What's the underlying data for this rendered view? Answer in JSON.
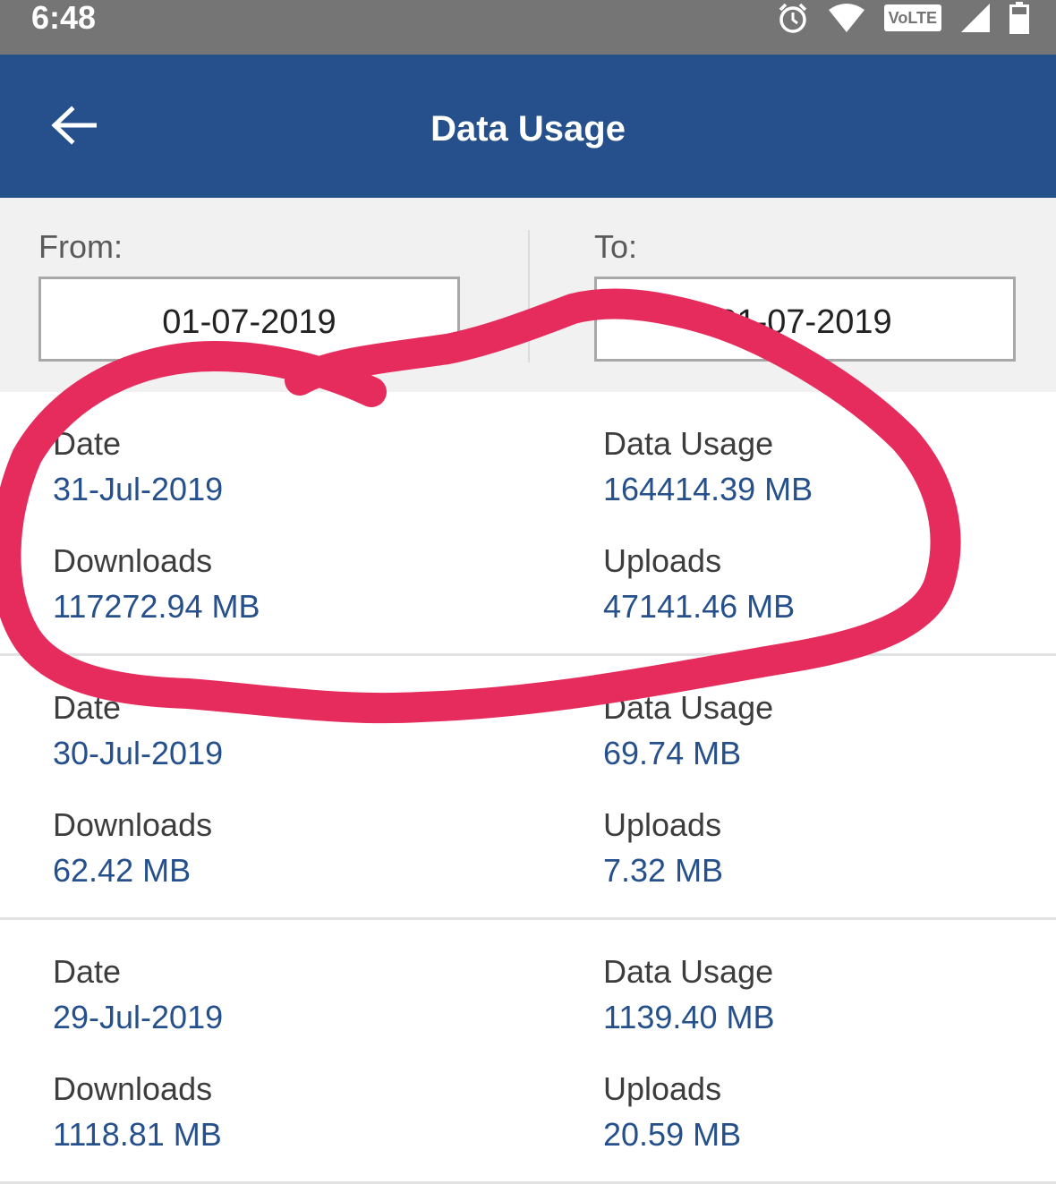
{
  "status_bar": {
    "time": "6:48",
    "icons": [
      "alarm-icon",
      "wifi-icon",
      "volte-badge",
      "signal-icon",
      "battery-icon"
    ],
    "volte_label": "VoLTE"
  },
  "app_bar": {
    "back_icon": "back-arrow-icon",
    "title": "Data Usage"
  },
  "date_range": {
    "from_label": "From:",
    "from_value": "01-07-2019",
    "to_label": "To:",
    "to_value": "31-07-2019"
  },
  "labels": {
    "date": "Date",
    "data_usage": "Data Usage",
    "downloads": "Downloads",
    "uploads": "Uploads"
  },
  "rows": [
    {
      "date": "31-Jul-2019",
      "data_usage": "164414.39 MB",
      "downloads": "117272.94 MB",
      "uploads": "47141.46 MB"
    },
    {
      "date": "30-Jul-2019",
      "data_usage": "69.74 MB",
      "downloads": "62.42 MB",
      "uploads": "7.32 MB"
    },
    {
      "date": "29-Jul-2019",
      "data_usage": "1139.40 MB",
      "downloads": "1118.81 MB",
      "uploads": "20.59 MB"
    }
  ],
  "colors": {
    "status_bar": "#757575",
    "app_bar": "#25508b",
    "value_text": "#25508b",
    "annotation_stroke": "#e52c5c"
  }
}
